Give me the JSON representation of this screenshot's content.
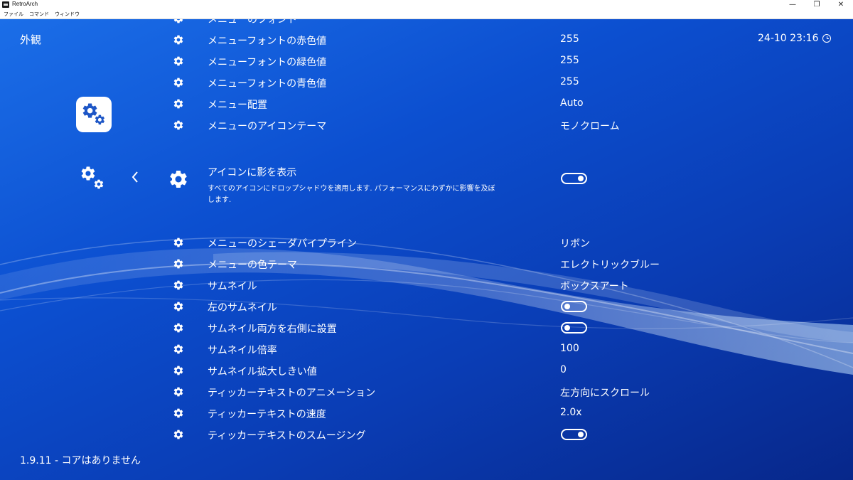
{
  "window": {
    "title": "RetroArch",
    "minimize": "—",
    "restore": "❐",
    "close": "✕"
  },
  "menubar": [
    "ファイル",
    "コマンド",
    "ウィンドウ"
  ],
  "header": {
    "title": "外観",
    "clock": "24-10 23:16"
  },
  "rows_top": [
    {
      "label": "メニューのフォント",
      "value": ""
    },
    {
      "label": "メニューフォントの赤色値",
      "value": "255"
    },
    {
      "label": "メニューフォントの緑色値",
      "value": "255"
    },
    {
      "label": "メニューフォントの青色値",
      "value": "255"
    },
    {
      "label": "メニュー配置",
      "value": "Auto"
    },
    {
      "label": "メニューのアイコンテーマ",
      "value": "モノクローム"
    }
  ],
  "active_item": {
    "label": "アイコンに影を表示",
    "description": "すべてのアイコンにドロップシャドウを適用します. パフォーマンスにわずかに影響を及ぼします.",
    "toggle": "on"
  },
  "rows_bottom": [
    {
      "label": "メニューのシェーダパイプライン",
      "value": "リボン"
    },
    {
      "label": "メニューの色テーマ",
      "value": "エレクトリックブルー"
    },
    {
      "label": "サムネイル",
      "value": "ボックスアート"
    },
    {
      "label": "左のサムネイル",
      "toggle": "off"
    },
    {
      "label": "サムネイル両方を右側に設置",
      "toggle": "off"
    },
    {
      "label": "サムネイル倍率",
      "value": "100"
    },
    {
      "label": "サムネイル拡大しきい値",
      "value": "0"
    },
    {
      "label": "ティッカーテキストのアニメーション",
      "value": "左方向にスクロール"
    },
    {
      "label": "ティッカーテキストの速度",
      "value": "2.0x"
    },
    {
      "label": "ティッカーテキストのスムージング",
      "toggle": "on"
    }
  ],
  "footer": {
    "status": "1.9.11 - コアはありません"
  },
  "colors": {
    "background_top": "#1b6ee8",
    "background_bottom": "#07278a",
    "text": "#ffffff"
  }
}
